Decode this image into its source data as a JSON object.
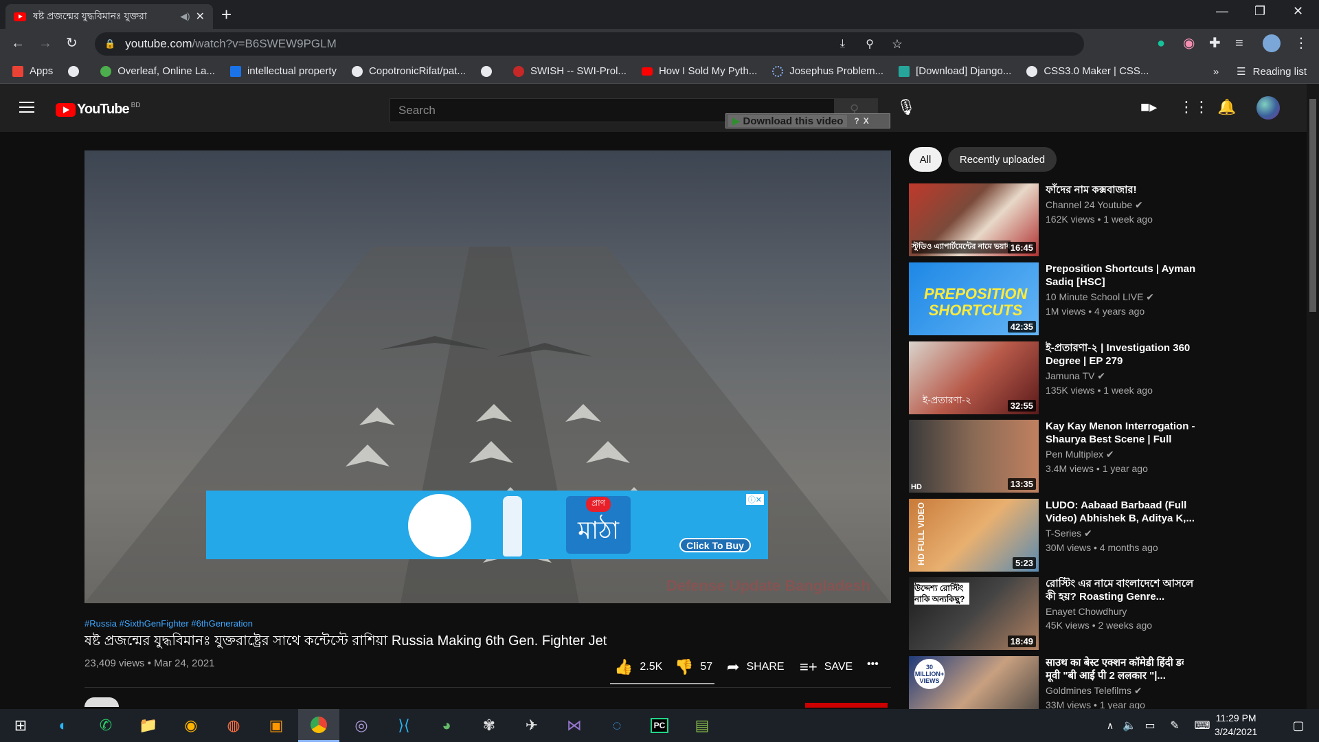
{
  "browser": {
    "tab_title": "ষষ্ট প্রজন্মের যুদ্ধবিমানঃ যুক্তরা",
    "url_host": "youtube.com",
    "url_path": "/watch?v=B6SWEW9PGLM",
    "bookmarks": [
      {
        "label": "Apps",
        "color": "#ea4335"
      },
      {
        "label": "",
        "color": "#e8eaed"
      },
      {
        "label": "Overleaf, Online La...",
        "color": "#4cae4c"
      },
      {
        "label": "intellectual property",
        "color": "#1a73e8"
      },
      {
        "label": "CopotronicRifat/pat...",
        "color": "#e8eaed"
      },
      {
        "label": "",
        "color": "#e8eaed"
      },
      {
        "label": "SWISH -- SWI-Prol...",
        "color": "#c62828"
      },
      {
        "label": "How I Sold My Pyth...",
        "color": "#ff0000"
      },
      {
        "label": "Josephus Problem...",
        "color": "#5f6368"
      },
      {
        "label": "[Download] Django...",
        "color": "#26a69a"
      },
      {
        "label": "CSS3.0 Maker | CSS...",
        "color": "#e8eaed"
      }
    ],
    "more": "»",
    "reading_list": "Reading list"
  },
  "youtube": {
    "logo_text": "YouTube",
    "region": "BD",
    "search_placeholder": "Search",
    "download_label": "Download this video",
    "download_help": "?",
    "download_close": "X"
  },
  "video": {
    "ad_brand": "প্রাণ",
    "ad_product": "মাঠা",
    "ad_cta": "Click To Buy",
    "watermark": "Defense Update Bangladesh",
    "tags": "#Russia #SixthGenFighter #6thGeneration",
    "title": "ষষ্ট প্রজন্মের যুদ্ধবিমানঃ যুক্তরাষ্ট্রের সাথে কন্টেস্টে রাশিয়া Russia Making 6th Gen. Fighter Jet",
    "views_date": "23,409 views • Mar 24, 2021",
    "likes": "2.5K",
    "dislikes": "57",
    "share": "SHARE",
    "save": "SAVE"
  },
  "chips": [
    "All",
    "Recently uploaded"
  ],
  "recommended": [
    {
      "title": "ফাঁদের নাম কক্সবাজার!",
      "channel": "Channel 24 Youtube ✔",
      "views": "162K views • 1 week ago",
      "duration": "16:45",
      "thumb_text": "স্টুডিও এ্যাপার্টমেন্টের নামে ভয়াব"
    },
    {
      "title": "Preposition Shortcuts | Ayman Sadiq [HSC]",
      "channel": "10 Minute School LIVE ✔",
      "views": "1M views • 4 years ago",
      "duration": "42:35",
      "thumb_text": "PREPOSITION SHORTCUTS"
    },
    {
      "title": "ই-প্রতারণা-২ | Investigation 360 Degree | EP 279",
      "channel": "Jamuna TV ✔",
      "views": "135K views • 1 week ago",
      "duration": "32:55",
      "thumb_text": "ই-প্রতারণা-২"
    },
    {
      "title": "Kay Kay Menon Interrogation - Shaurya Best Scene | Full Hind...",
      "channel": "Pen Multiplex ✔",
      "views": "3.4M views • 1 year ago",
      "duration": "13:35",
      "thumb_text": "HD"
    },
    {
      "title": "LUDO: Aabaad Barbaad (Full Video) Abhishek B, Aditya K,...",
      "channel": "T-Series ✔",
      "views": "30M views • 4 months ago",
      "duration": "5:23",
      "thumb_text": "HD FULL VIDEO"
    },
    {
      "title": "রোস্টিং এর নামে বাংলাদেশে আসলে কী হয়? Roasting Genre...",
      "channel": "Enayet Chowdhury",
      "views": "45K views • 2 weeks ago",
      "duration": "18:49",
      "thumb_text": "উদ্দেশ্য রোস্টিং নাকি অন্যকিছু?"
    },
    {
      "title": "साउथ का बेस्ट एक्शन कॉमेडी हिंदी डब्ड मूवी \"बी आई पी 2 ललकार \"|...",
      "channel": "Goldmines Telefilms ✔",
      "views": "33M views • 1 year ago",
      "duration": "",
      "thumb_text": "30 MILLION+ VIEWS"
    }
  ],
  "taskbar": {
    "time": "11:29 PM",
    "date": "3/24/2021"
  }
}
